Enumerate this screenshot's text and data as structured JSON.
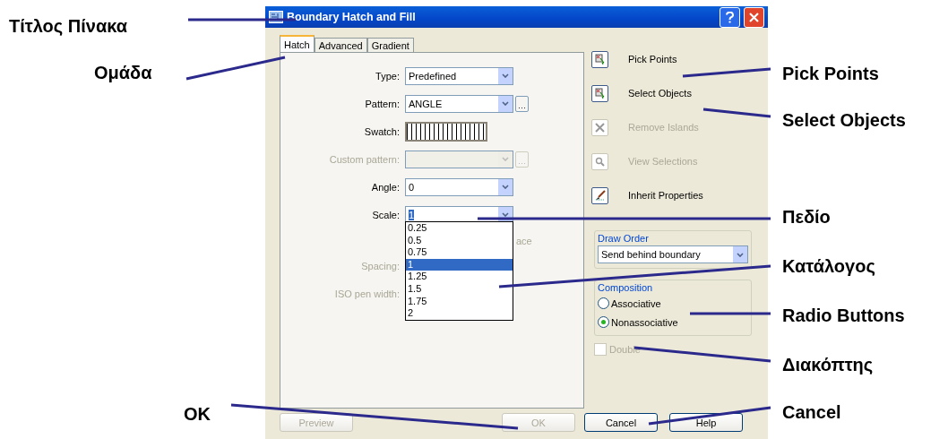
{
  "annotations": [
    {
      "text": "Τίτλος Πίνακα"
    },
    {
      "text": "Ομάδα"
    },
    {
      "text": "OK"
    },
    {
      "text": "Pick Points"
    },
    {
      "text": "Select Objects"
    },
    {
      "text": "Πεδίο"
    },
    {
      "text": "Κατάλογος"
    },
    {
      "text": "Radio Buttons"
    },
    {
      "text": "Διακόπτης"
    },
    {
      "text": "Cancel"
    }
  ],
  "dialog": {
    "title": "Boundary Hatch and Fill",
    "tabs": [
      {
        "label": "Hatch",
        "selected": true
      },
      {
        "label": "Advanced",
        "selected": false
      },
      {
        "label": "Gradient",
        "selected": false
      }
    ],
    "fields": [
      {
        "kind": "dropdown",
        "label": "Type:",
        "value": "Predefined",
        "disabled": false,
        "browse": false
      },
      {
        "kind": "dropdown",
        "label": "Pattern:",
        "value": "ANGLE",
        "disabled": false,
        "browse": true
      },
      {
        "kind": "swatch",
        "label": "Swatch:",
        "disabled": false
      },
      {
        "kind": "dropdown",
        "label": "Custom pattern:",
        "disabled": true,
        "browse": true
      },
      {
        "kind": "dropdown",
        "label": "Angle:",
        "value": "0",
        "disabled": false,
        "browse": false
      },
      {
        "kind": "dropdown",
        "label": "Scale:",
        "value": "1",
        "disabled": false,
        "browse": false,
        "expanded": true
      }
    ],
    "dropdown_list": [
      {
        "label": "0.25",
        "selected": false
      },
      {
        "label": "0.5",
        "selected": false
      },
      {
        "label": "0.75",
        "selected": false
      },
      {
        "label": "1",
        "selected": true
      },
      {
        "label": "1.25",
        "selected": false
      },
      {
        "label": "1.5",
        "selected": false
      },
      {
        "label": "1.75",
        "selected": false
      },
      {
        "label": "2",
        "selected": false
      }
    ],
    "covered_text": "ace",
    "hidden_labels": [
      "Spacing:",
      "ISO pen width:"
    ],
    "actions": [
      {
        "kind": "pick",
        "label": "Pick Points",
        "disabled": false
      },
      {
        "kind": "select",
        "label": "Select Objects",
        "disabled": false
      },
      {
        "kind": "remove",
        "label": "Remove Islands",
        "disabled": true
      },
      {
        "kind": "view",
        "label": "View Selections",
        "disabled": true
      },
      {
        "kind": "inherit",
        "label": "Inherit Properties",
        "disabled": false
      }
    ],
    "draw_order": {
      "title": "Draw Order",
      "value": "Send behind boundary"
    },
    "composition": {
      "title": "Composition",
      "options": [
        {
          "label": "Associative",
          "selected": false
        },
        {
          "label": "Nonassociative",
          "selected": true
        }
      ]
    },
    "double": {
      "label": "Double",
      "checked": false,
      "disabled": true
    },
    "buttons": [
      {
        "label": "Preview",
        "disabled": true
      },
      {
        "label": "OK",
        "disabled": true
      },
      {
        "label": "Cancel",
        "disabled": false
      },
      {
        "label": "Help",
        "disabled": false
      }
    ]
  }
}
